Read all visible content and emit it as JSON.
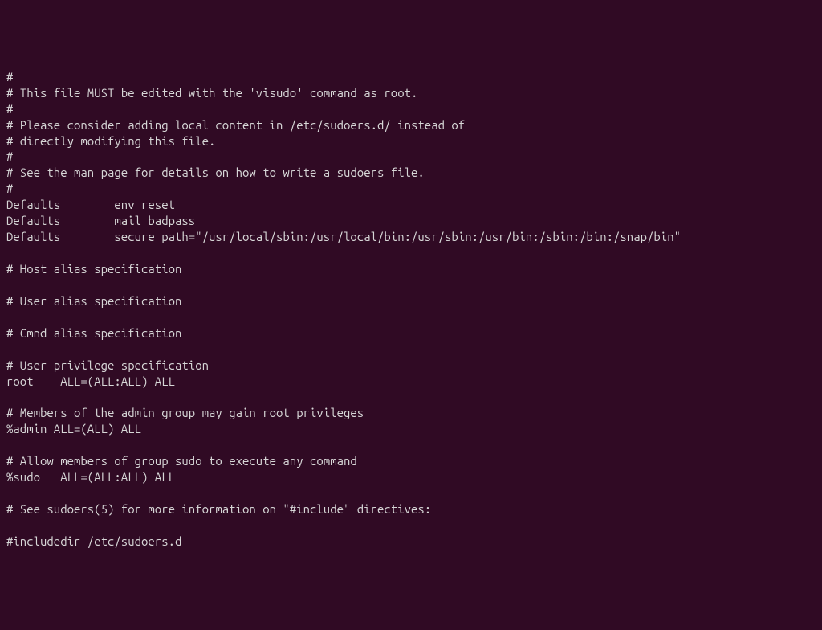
{
  "lines": [
    "#",
    "# This file MUST be edited with the 'visudo' command as root.",
    "#",
    "# Please consider adding local content in /etc/sudoers.d/ instead of",
    "# directly modifying this file.",
    "#",
    "# See the man page for details on how to write a sudoers file.",
    "#",
    "Defaults        env_reset",
    "Defaults        mail_badpass",
    "Defaults        secure_path=\"/usr/local/sbin:/usr/local/bin:/usr/sbin:/usr/bin:/sbin:/bin:/snap/bin\"",
    "",
    "# Host alias specification",
    "",
    "# User alias specification",
    "",
    "# Cmnd alias specification",
    "",
    "# User privilege specification",
    "root    ALL=(ALL:ALL) ALL",
    "",
    "# Members of the admin group may gain root privileges",
    "%admin ALL=(ALL) ALL",
    "",
    "# Allow members of group sudo to execute any command",
    "%sudo   ALL=(ALL:ALL) ALL",
    "",
    "# See sudoers(5) for more information on \"#include\" directives:",
    "",
    "#includedir /etc/sudoers.d"
  ]
}
